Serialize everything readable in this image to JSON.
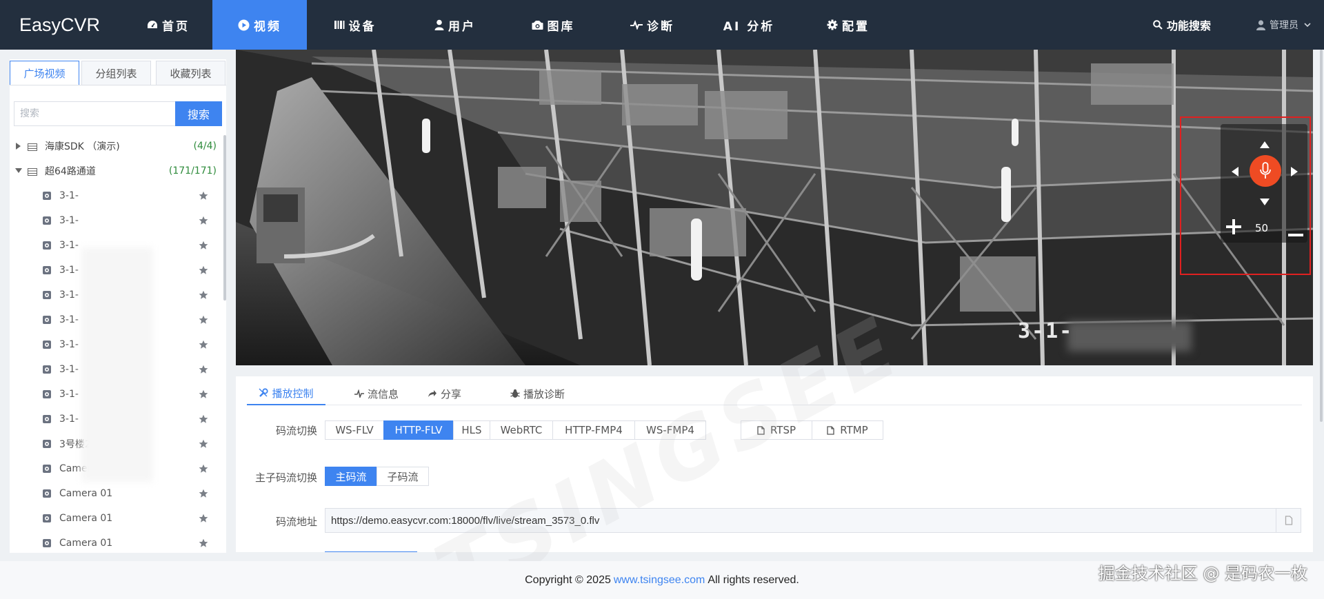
{
  "app": {
    "brand": "EasyCVR"
  },
  "nav": {
    "items": [
      {
        "label": "首页",
        "icon": "dashboard-icon"
      },
      {
        "label": "视频",
        "icon": "play-circle-icon",
        "active": true
      },
      {
        "label": "设备",
        "icon": "device-icon"
      },
      {
        "label": "用户",
        "icon": "user-icon"
      },
      {
        "label": "图库",
        "icon": "gallery-icon"
      },
      {
        "label": "诊断",
        "icon": "pulse-icon"
      },
      {
        "label": "AI 分析",
        "icon": ""
      },
      {
        "label": "配置",
        "icon": "gear-icon"
      }
    ],
    "feature_search": "功能搜索",
    "user": "管理员"
  },
  "sidebar": {
    "tabs": [
      "广场视频",
      "分组列表",
      "收藏列表"
    ],
    "search_placeholder": "搜索",
    "search_button": "搜索",
    "groups": [
      {
        "label": "海康SDK （演示)",
        "count": "(4/4)",
        "expanded": false
      },
      {
        "label": "超64路通道",
        "count": "(171/171)",
        "expanded": true
      }
    ],
    "cameras": [
      "3-1-",
      "3-1-",
      "3-1-",
      "3-1-",
      "3-1-",
      "3-1-",
      "3-1-",
      "3-1-",
      "3-1-",
      "3-1-",
      "3号楼2楼",
      "Camera 01",
      "Camera 01",
      "Camera 01",
      "Camera 01"
    ]
  },
  "video": {
    "overlay_text": "3-1-",
    "ptz": {
      "zoom_value": "50"
    }
  },
  "panel": {
    "tabs": [
      {
        "label": "播放控制",
        "icon": "tools-icon",
        "active": true
      },
      {
        "label": "流信息",
        "icon": "pulse-icon"
      },
      {
        "label": "分享",
        "icon": "share-icon"
      },
      {
        "label": "播放诊断",
        "icon": "bug-icon"
      }
    ],
    "stream_switch_label": "码流切换",
    "stream_types": [
      "WS-FLV",
      "HTTP-FLV",
      "HLS",
      "WebRTC",
      "HTTP-FMP4",
      "WS-FMP4"
    ],
    "stream_active": "HTTP-FLV",
    "protocols": [
      "RTSP",
      "RTMP"
    ],
    "substream_label": "主子码流切换",
    "substreams": [
      "主码流",
      "子码流"
    ],
    "substream_active": "主码流",
    "url_label": "码流地址",
    "url_value": "https://demo.easycvr.com:18000/flv/live/stream_3573_0.flv"
  },
  "watermark": "TSINGSEE",
  "footer": {
    "prefix": "Copyright © 2025",
    "link": "www.tsingsee.com",
    "suffix": "All rights reserved."
  },
  "corner_watermark": "掘金技术社区 @ 是码农一枚",
  "colors": {
    "nav_bg": "#232f3e",
    "accent": "#3e84f0",
    "ptz_red": "#ef4b23",
    "count_green": "#2e8b3b"
  }
}
